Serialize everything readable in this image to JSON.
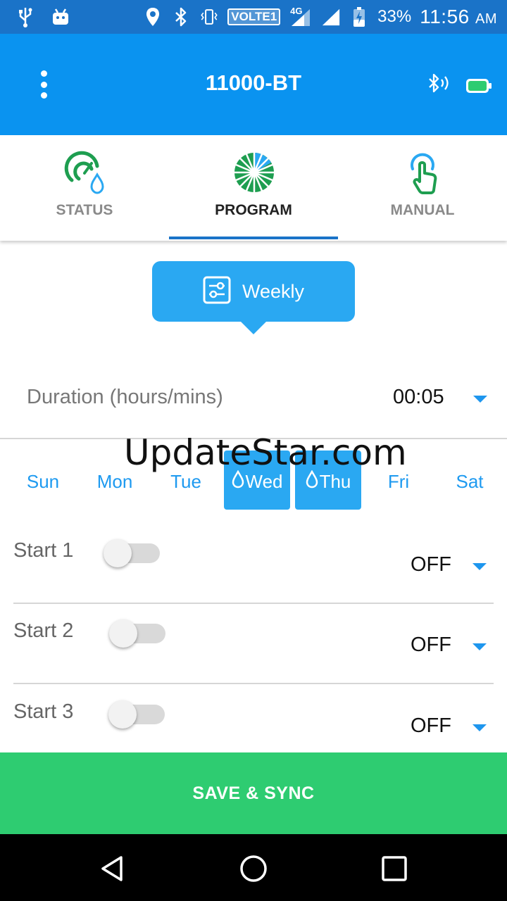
{
  "status_bar": {
    "network_label": "VOLTE1",
    "network_type": "4G",
    "battery_percent": "33%",
    "time": "11:56",
    "time_suffix": "AM"
  },
  "app_bar": {
    "title": "11000-BT"
  },
  "tabs": [
    {
      "label": "STATUS",
      "icon": "status-gauge-drop-icon",
      "active": false
    },
    {
      "label": "PROGRAM",
      "icon": "program-wheel-icon",
      "active": true
    },
    {
      "label": "MANUAL",
      "icon": "manual-touch-icon",
      "active": false
    }
  ],
  "mode": {
    "label": "Weekly",
    "icon": "settings-sliders-icon"
  },
  "duration": {
    "label": "Duration (hours/mins)",
    "value": "00:05"
  },
  "watermark": "UpdateStar.com",
  "days": [
    {
      "label": "Sun",
      "selected": false
    },
    {
      "label": "Mon",
      "selected": false
    },
    {
      "label": "Tue",
      "selected": false
    },
    {
      "label": "Wed",
      "selected": true
    },
    {
      "label": "Thu",
      "selected": true
    },
    {
      "label": "Fri",
      "selected": false
    },
    {
      "label": "Sat",
      "selected": false
    }
  ],
  "starts": [
    {
      "label": "Start 1",
      "enabled": false,
      "value": "OFF"
    },
    {
      "label": "Start 2",
      "enabled": false,
      "value": "OFF"
    },
    {
      "label": "Start 3",
      "enabled": false,
      "value": "OFF"
    }
  ],
  "save_button": {
    "label": "SAVE & SYNC"
  },
  "colors": {
    "status_bar": "#1a73c8",
    "app_bar": "#0a93f0",
    "accent": "#2aa8f2",
    "save": "#2ecc71",
    "icon_green": "#1e9e50"
  }
}
